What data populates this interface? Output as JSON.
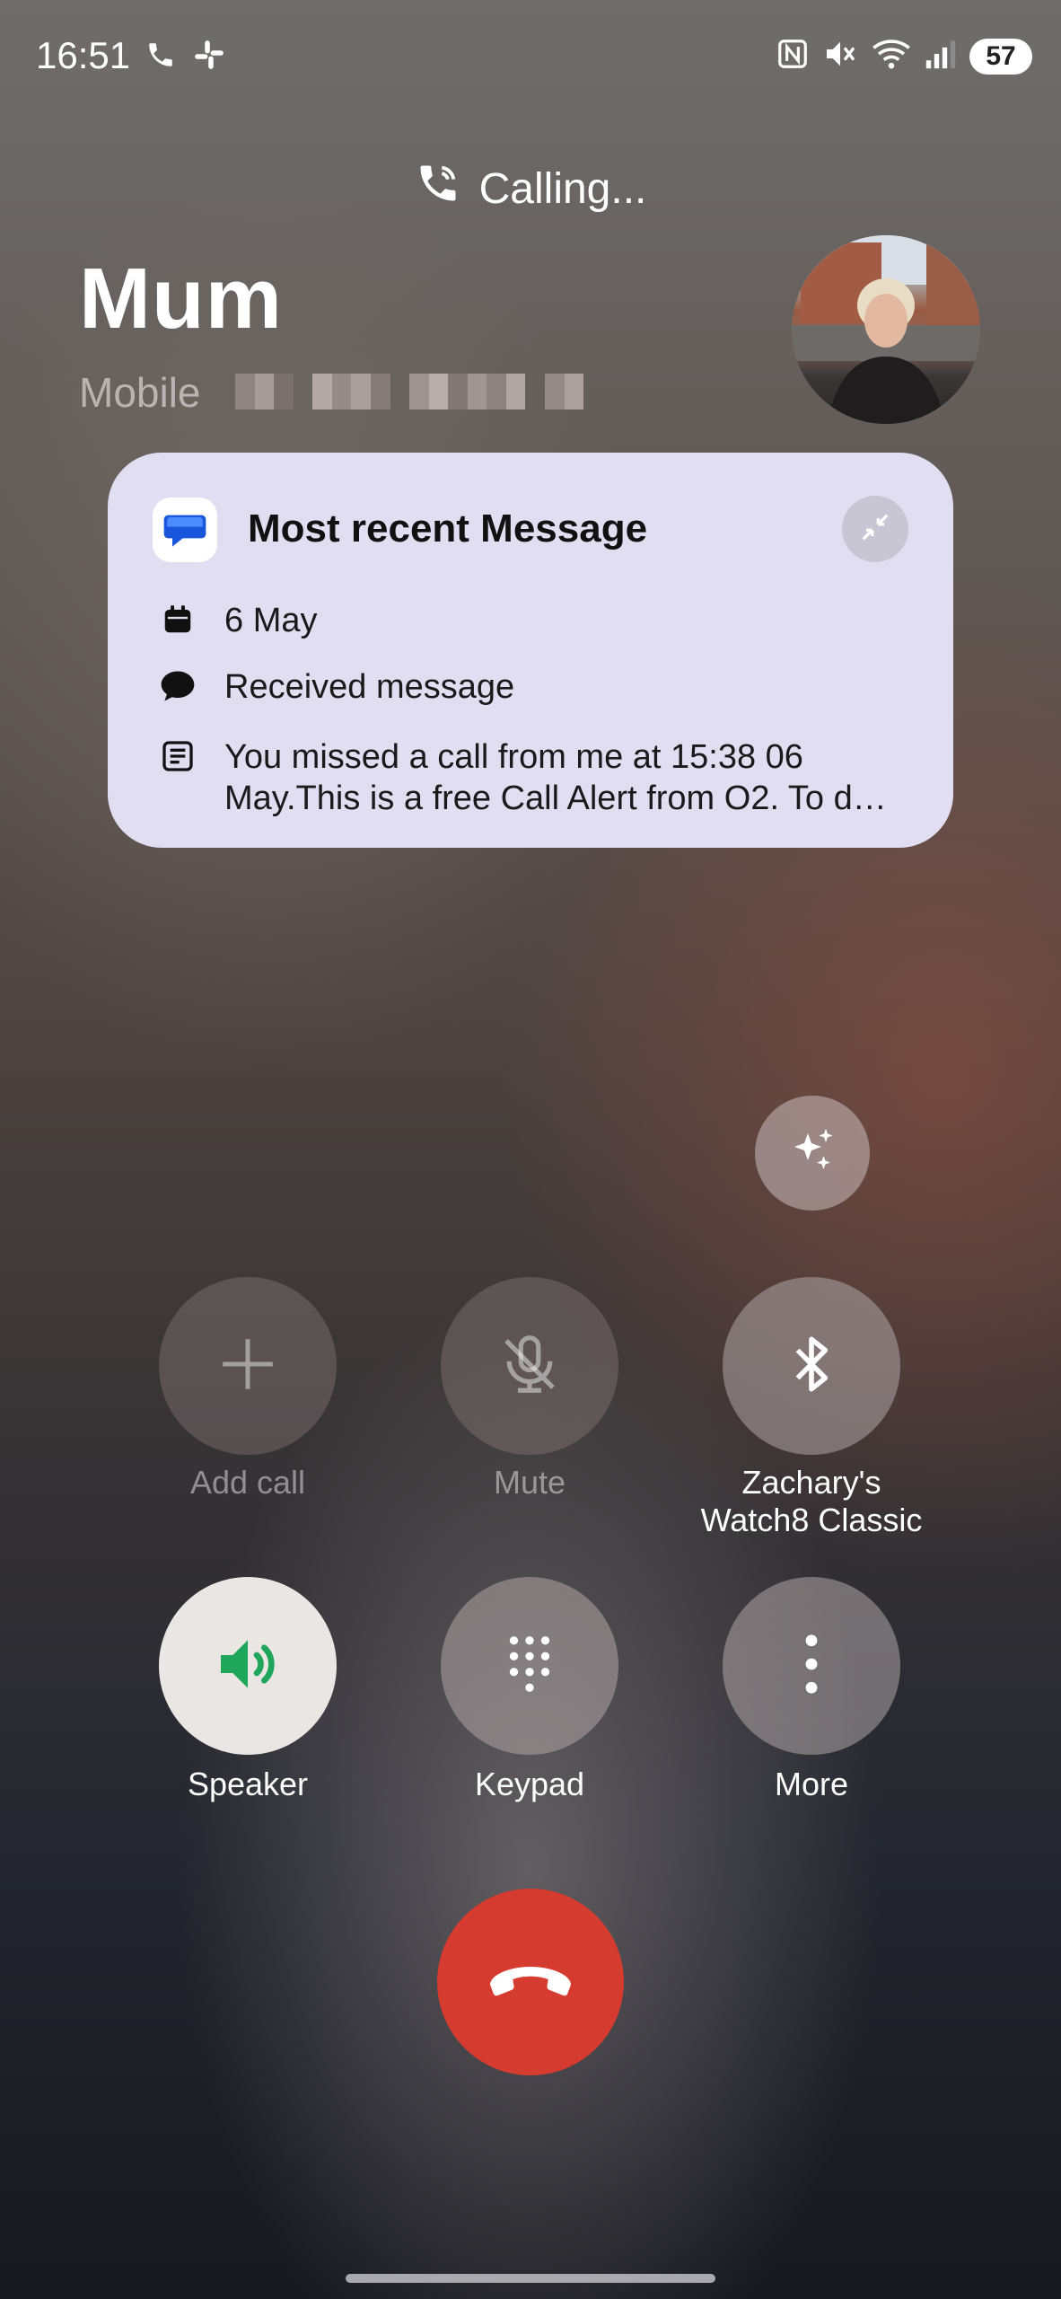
{
  "status_bar": {
    "time": "16:51",
    "battery": "57",
    "icons": [
      "phone-call-icon",
      "slack-icon",
      "nfc-icon",
      "mute-icon",
      "wifi-icon",
      "signal-icon",
      "battery-icon"
    ]
  },
  "call": {
    "status": "Calling...",
    "contact_name": "Mum",
    "number_type": "Mobile"
  },
  "message_card": {
    "title": "Most recent Message",
    "date": "6 May",
    "type": "Received message",
    "preview_line1": "You missed a call from me at 15:38 06",
    "preview_line2": "May.This is a free Call Alert from O2. To d…"
  },
  "controls": {
    "add_call": "Add call",
    "mute": "Mute",
    "bluetooth_line1": "Zachary's",
    "bluetooth_line2": "Watch8 Classic",
    "speaker": "Speaker",
    "keypad": "Keypad",
    "more": "More"
  },
  "colors": {
    "end_call": "#d63b30",
    "speaker_icon": "#1fa65a",
    "card_bg": "#e2def2"
  }
}
